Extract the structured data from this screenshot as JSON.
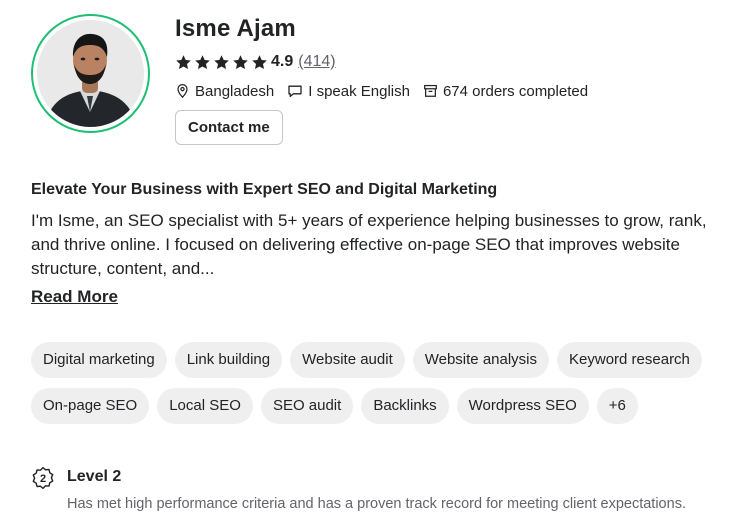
{
  "profile": {
    "name": "Isme Ajam",
    "avatar_ring_color": "#1dbf73",
    "rating": {
      "stars": 5,
      "score": "4.9",
      "count": "(414)"
    },
    "location": "Bangladesh",
    "language": "I speak English",
    "orders": "674 orders completed",
    "contact_label": "Contact me"
  },
  "about": {
    "headline": "Elevate Your Business with Expert SEO and Digital Marketing",
    "description": "I'm Isme, an SEO specialist with 5+ years of experience helping businesses to grow, rank, and thrive online. I focused on delivering effective on-page SEO that improves website structure, content, and...",
    "read_more": "Read More"
  },
  "skills": [
    "Digital marketing",
    "Link building",
    "Website audit",
    "Website analysis",
    "Keyword research",
    "On-page SEO",
    "Local SEO",
    "SEO audit",
    "Backlinks",
    "Wordpress SEO",
    "+6"
  ],
  "level": {
    "badge": "2",
    "title": "Level 2",
    "description": "Has met high performance criteria and has a proven track record for meeting client expectations."
  },
  "icons": {
    "star": "star-icon",
    "location": "location-pin-icon",
    "language": "chat-bubble-icon",
    "orders": "archive-box-icon",
    "level": "level-badge-icon"
  }
}
